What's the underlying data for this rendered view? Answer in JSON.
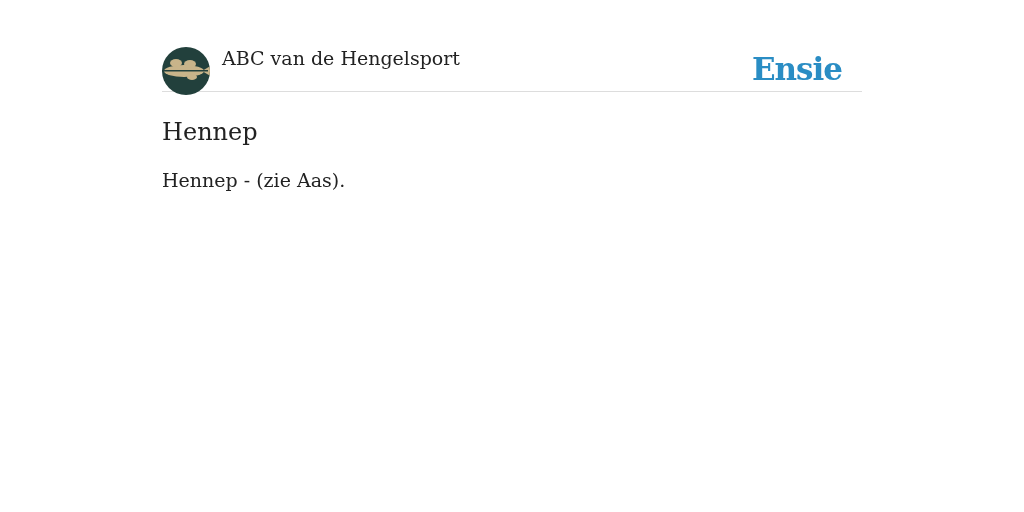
{
  "header": {
    "book_title": "ABC van de Hengelsport",
    "logo": "Ensie"
  },
  "article": {
    "title": "Hennep",
    "text": "Hennep - (zie Aas)."
  }
}
